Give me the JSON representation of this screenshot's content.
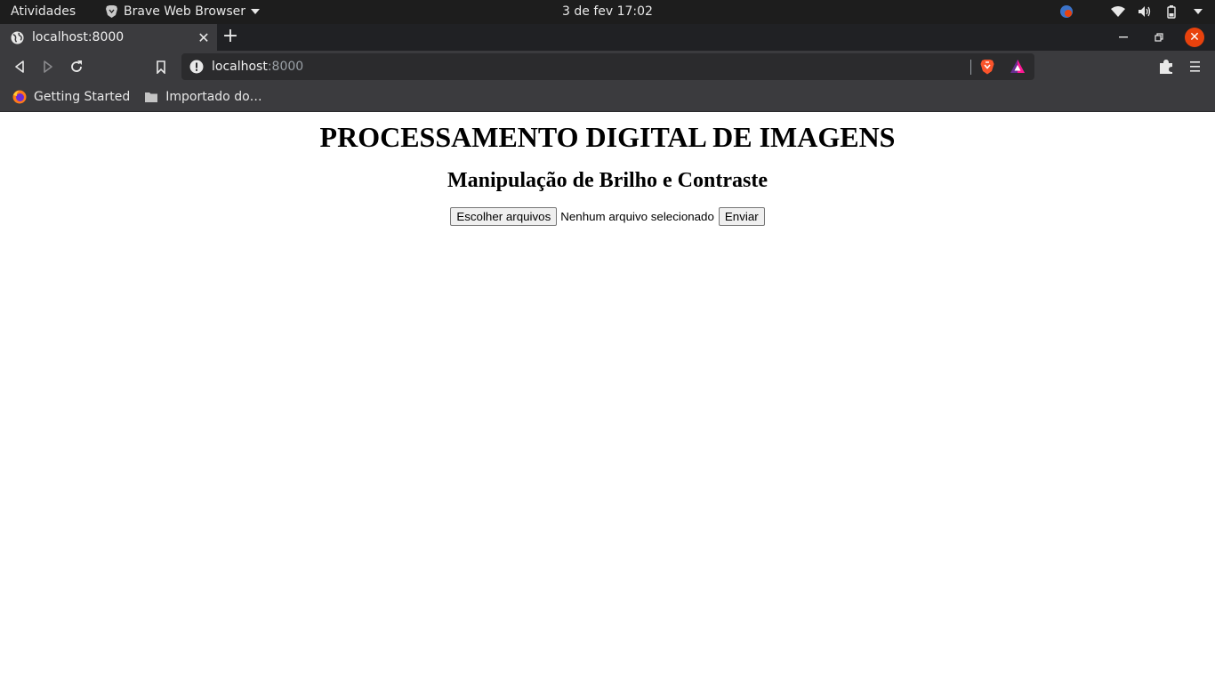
{
  "system_bar": {
    "activities": "Atividades",
    "app_name": "Brave Web Browser",
    "datetime": "3 de fev  17:02"
  },
  "tab": {
    "title": "localhost:8000"
  },
  "address_bar": {
    "host": "localhost",
    "port": ":8000"
  },
  "bookmarks": [
    {
      "label": "Getting Started",
      "icon": "firefox-icon"
    },
    {
      "label": "Importado do…",
      "icon": "folder-icon"
    }
  ],
  "page": {
    "title": "PROCESSAMENTO DIGITAL DE IMAGENS",
    "subtitle": "Manipulação de Brilho e Contraste",
    "file_button": "Escolher arquivos",
    "file_status": "Nenhum arquivo selecionado",
    "submit_button": "Enviar"
  },
  "colors": {
    "system_bar": "#1d1d1d",
    "browser_chrome": "#3b3b3e",
    "close_button": "#e8420d",
    "brave_orange": "#fb542b"
  }
}
